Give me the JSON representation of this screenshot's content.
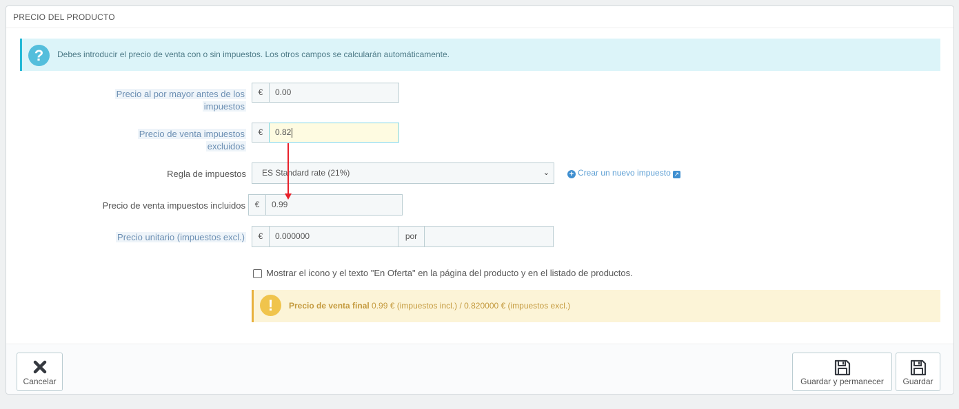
{
  "panel": {
    "heading": "PRECIO DEL PRODUCTO"
  },
  "info": {
    "icon": "question-icon",
    "text": "Debes introducir el precio de venta con o sin impuestos. Los otros campos se calcularán automáticamente."
  },
  "wholesale": {
    "label_line1": "Precio al por mayor antes de los",
    "label_line2": "impuestos",
    "currency": "€",
    "value": "0.00"
  },
  "price_excl": {
    "label_line1": "Precio de venta impuestos",
    "label_line2": "excluidos",
    "currency": "€",
    "value": "0.82"
  },
  "tax_rule": {
    "label": "Regla de impuestos",
    "selected": "ES Standard rate (21%)",
    "create_link": "Crear un nuevo impuesto"
  },
  "price_incl": {
    "label": "Precio de venta impuestos incluidos",
    "currency": "€",
    "value": "0.99"
  },
  "unit_price": {
    "label": "Precio unitario (impuestos excl.)",
    "currency": "€",
    "value": "0.000000",
    "per_label": "por",
    "unit_value": ""
  },
  "on_sale": {
    "checked": false,
    "label": "Mostrar el icono y el texto \"En Oferta\" en la página del producto y en el listado de productos."
  },
  "final_price": {
    "icon": "exclamation-icon",
    "bold": "Precio de venta final",
    "text": " 0.99 € (impuestos incl.) / 0.820000 € (impuestos excl.)"
  },
  "footer": {
    "cancel_label": "Cancelar",
    "save_stay_label": "Guardar y permanecer",
    "save_label": "Guardar"
  },
  "colors": {
    "info_bg": "#dcf4f9",
    "warning_bg": "#fcf4d7",
    "annotation_arrow": "#e8202a"
  }
}
